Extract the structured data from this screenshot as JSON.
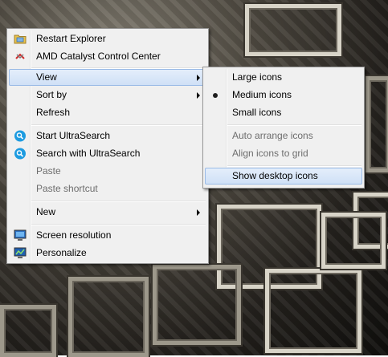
{
  "context_menu": {
    "items": [
      {
        "label": "Restart Explorer",
        "icon": "folder-refresh-icon"
      },
      {
        "label": "AMD Catalyst Control Center",
        "icon": "amd-catalyst-icon"
      },
      {
        "label": "View",
        "has_submenu": true,
        "highlighted": true
      },
      {
        "label": "Sort by",
        "has_submenu": true
      },
      {
        "label": "Refresh"
      },
      {
        "label": "Start UltraSearch",
        "icon": "ultrasearch-icon"
      },
      {
        "label": "Search with UltraSearch",
        "icon": "ultrasearch-icon"
      },
      {
        "label": "Paste",
        "disabled": true
      },
      {
        "label": "Paste shortcut",
        "disabled": true
      },
      {
        "label": "New",
        "has_submenu": true
      },
      {
        "label": "Screen resolution",
        "icon": "screen-resolution-icon"
      },
      {
        "label": "Personalize",
        "icon": "personalize-icon"
      }
    ]
  },
  "view_submenu": {
    "items": [
      {
        "label": "Large icons"
      },
      {
        "label": "Medium icons",
        "selected": true
      },
      {
        "label": "Small icons"
      },
      {
        "label": "Auto arrange icons",
        "disabled": true
      },
      {
        "label": "Align icons to grid",
        "disabled": true
      },
      {
        "label": "Show desktop icons",
        "highlighted": true
      }
    ]
  },
  "colors": {
    "menu_background": "#f0f0f0",
    "highlight_fill": "#d5e3f7",
    "highlight_border": "#9bbbe6",
    "disabled_text": "#6d6d6d"
  }
}
